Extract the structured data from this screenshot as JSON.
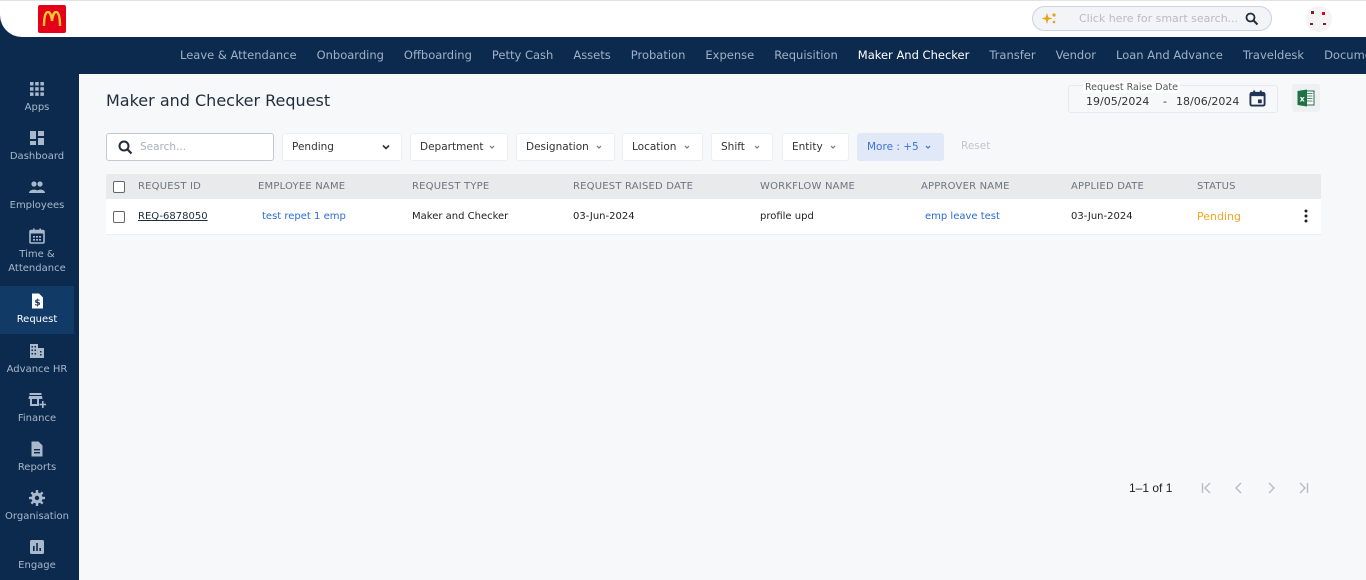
{
  "header": {
    "logo_alt": "McDonald's",
    "smart_search_placeholder": "Click here for smart search...",
    "brand_color": "#e4001b"
  },
  "module_nav": {
    "items": [
      {
        "label": "Leave & Attendance",
        "active": false
      },
      {
        "label": "Onboarding",
        "active": false
      },
      {
        "label": "Offboarding",
        "active": false
      },
      {
        "label": "Petty Cash",
        "active": false
      },
      {
        "label": "Assets",
        "active": false
      },
      {
        "label": "Probation",
        "active": false
      },
      {
        "label": "Expense",
        "active": false
      },
      {
        "label": "Requisition",
        "active": false
      },
      {
        "label": "Maker And Checker",
        "active": true
      },
      {
        "label": "Transfer",
        "active": false
      },
      {
        "label": "Vendor",
        "active": false
      },
      {
        "label": "Loan And Advance",
        "active": false
      },
      {
        "label": "Traveldesk",
        "active": false
      },
      {
        "label": "Document",
        "active": false
      }
    ]
  },
  "sidebar": {
    "items": [
      {
        "label": "Apps",
        "icon": "apps-grid-icon"
      },
      {
        "label": "Dashboard",
        "icon": "dashboard-icon"
      },
      {
        "label": "Employees",
        "icon": "people-icon"
      },
      {
        "label": "Time & Attendance",
        "icon": "calendar-icon"
      },
      {
        "label": "Request",
        "icon": "request-dollar-icon",
        "active": true
      },
      {
        "label": "Advance HR",
        "icon": "building-icon"
      },
      {
        "label": "Finance",
        "icon": "store-add-icon"
      },
      {
        "label": "Reports",
        "icon": "document-icon"
      },
      {
        "label": "Organisation",
        "icon": "gear-icon"
      },
      {
        "label": "Engage",
        "icon": "bar-chart-icon"
      }
    ]
  },
  "page": {
    "title": "Maker and Checker Request",
    "date_range": {
      "label": "Request Raise Date",
      "from": "19/05/2024",
      "separator": "-",
      "to": "18/06/2024"
    }
  },
  "filters": {
    "search_placeholder": "Search...",
    "status": "Pending",
    "department": "Department",
    "designation": "Designation",
    "location": "Location",
    "shift": "Shift",
    "entity": "Entity",
    "more": "More : +5",
    "reset": "Reset"
  },
  "table": {
    "columns": [
      "REQUEST ID",
      "EMPLOYEE NAME",
      "REQUEST TYPE",
      "REQUEST RAISED DATE",
      "WORKFLOW NAME",
      "APPROVER NAME",
      "APPLIED DATE",
      "STATUS"
    ],
    "rows": [
      {
        "request_id": "REQ-6878050",
        "employee_name": "test repet 1 emp",
        "request_type": "Maker and Checker",
        "request_raised_date": "03-Jun-2024",
        "workflow_name": "profile upd",
        "approver_name": "emp leave test",
        "applied_date": "03-Jun-2024",
        "status": "Pending"
      }
    ],
    "status_color": "#f5a623",
    "link_color": "#2b6cd2"
  },
  "pagination": {
    "range": "1–1 of 1"
  }
}
